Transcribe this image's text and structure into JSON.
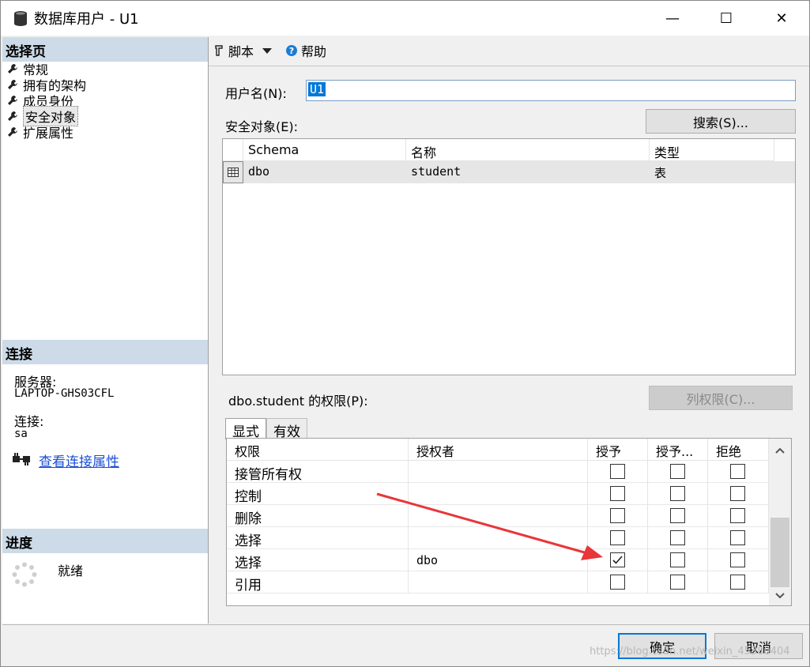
{
  "window": {
    "title": "数据库用户 - U1",
    "controls": {
      "minimize": "—",
      "maximize": "☐",
      "close": "✕"
    }
  },
  "left": {
    "select_page": {
      "heading": "选择页",
      "items": [
        {
          "label": "常规",
          "icon": "wrench-icon"
        },
        {
          "label": "拥有的架构",
          "icon": "wrench-icon"
        },
        {
          "label": "成员身份",
          "icon": "wrench-icon"
        },
        {
          "label": "安全对象",
          "icon": "wrench-icon",
          "selected": true
        },
        {
          "label": "扩展属性",
          "icon": "wrench-icon"
        }
      ]
    },
    "connection": {
      "heading": "连接",
      "server_label": "服务器:",
      "server_value": "LAPTOP-GHS03CFL",
      "conn_label": "连接:",
      "conn_value": "sa",
      "link": "查看连接属性"
    },
    "progress": {
      "heading": "进度",
      "status": "就绪"
    }
  },
  "toolbar": {
    "script": "脚本",
    "help": "帮助"
  },
  "form": {
    "username_label": "用户名(N):",
    "username_value": "U1",
    "securables_label": "安全对象(E):",
    "search_button": "搜索(S)...",
    "securables_table": {
      "columns": [
        "Schema",
        "名称",
        "类型"
      ],
      "rows": [
        {
          "schema": "dbo",
          "name": "student",
          "type": "表"
        }
      ]
    },
    "permissions_label": "dbo.student 的权限(P):",
    "column_perms_button": "列权限(C)...",
    "tabs": [
      "显式",
      "有效"
    ],
    "permissions_table": {
      "columns": [
        "权限",
        "授权者",
        "授予",
        "授予...",
        "拒绝"
      ],
      "rows": [
        {
          "permission": "接管所有权",
          "grantor": "",
          "grant": false,
          "with_grant": false,
          "deny": false
        },
        {
          "permission": "控制",
          "grantor": "",
          "grant": false,
          "with_grant": false,
          "deny": false
        },
        {
          "permission": "删除",
          "grantor": "",
          "grant": false,
          "with_grant": false,
          "deny": false
        },
        {
          "permission": "选择",
          "grantor": "",
          "grant": false,
          "with_grant": false,
          "deny": false
        },
        {
          "permission": "选择",
          "grantor": "dbo",
          "grant": true,
          "with_grant": false,
          "deny": false
        },
        {
          "permission": "引用",
          "grantor": "",
          "grant": false,
          "with_grant": false,
          "deny": false
        }
      ]
    }
  },
  "footer": {
    "ok": "确定",
    "cancel": "取消",
    "watermark": "https://blog.csdn.net/weixin_45380404"
  },
  "colors": {
    "section_header": "#cddbe8",
    "link": "#1a4fd6",
    "annotation_arrow": "#e8363a",
    "selection": "#0078d7"
  }
}
